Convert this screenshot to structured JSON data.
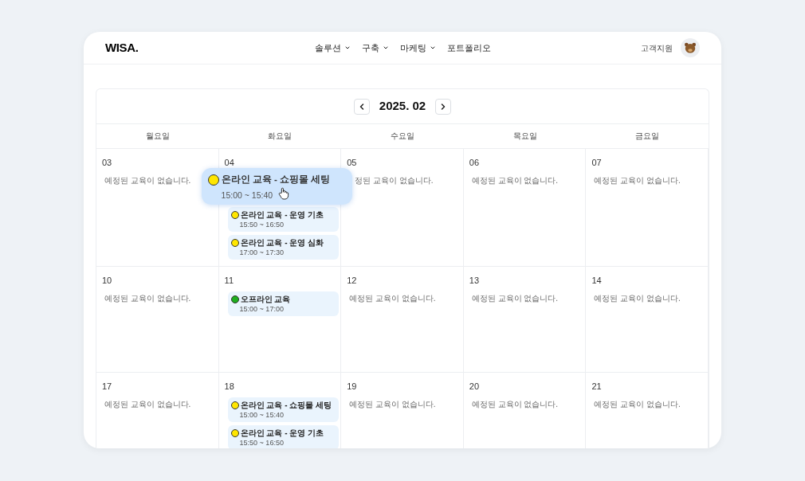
{
  "header": {
    "logo": "WISA.",
    "nav": [
      {
        "label": "솔루션",
        "has_menu": true
      },
      {
        "label": "구축",
        "has_menu": true
      },
      {
        "label": "마케팅",
        "has_menu": true
      },
      {
        "label": "포트폴리오",
        "has_menu": false
      }
    ],
    "support": "고객지원"
  },
  "calendar": {
    "month": "2025. 02",
    "weekdays": [
      "월요일",
      "화요일",
      "수요일",
      "목요일",
      "금요일"
    ],
    "weeks": [
      [
        {
          "date": "03",
          "empty": "예정된 교육이 없습니다.",
          "covered": false
        },
        {
          "date": "04",
          "events": [
            {
              "title": "온라인 교육 - 쇼핑몰 세팅",
              "time": "15:00 ~ 15:40",
              "color": "#ffe600",
              "dragging": true
            },
            {
              "title": "온라인 교육 - 운영 기초",
              "time": "15:50 ~ 16:50",
              "color": "#ffe600",
              "dragging": false
            },
            {
              "title": "온라인 교육 - 운영 심화",
              "time": "17:00 ~ 17:30",
              "color": "#ffe600",
              "dragging": false
            }
          ]
        },
        {
          "date": "05",
          "empty": "정된 교육이 없습니다.",
          "covered": true
        },
        {
          "date": "06",
          "empty": "예정된 교육이 없습니다.",
          "covered": false
        },
        {
          "date": "07",
          "empty": "예정된 교육이 없습니다.",
          "covered": false
        }
      ],
      [
        {
          "date": "10",
          "empty": "예정된 교육이 없습니다.",
          "covered": false
        },
        {
          "date": "11",
          "events": [
            {
              "title": "오프라인 교육",
              "time": "15:00 ~ 17:00",
              "color": "#1fae1f",
              "dragging": false
            }
          ]
        },
        {
          "date": "12",
          "empty": "예정된 교육이 없습니다.",
          "covered": false
        },
        {
          "date": "13",
          "empty": "예정된 교육이 없습니다.",
          "covered": false
        },
        {
          "date": "14",
          "empty": "예정된 교육이 없습니다.",
          "covered": false
        }
      ],
      [
        {
          "date": "17",
          "empty": "예정된 교육이 없습니다.",
          "covered": false
        },
        {
          "date": "18",
          "events": [
            {
              "title": "온라인 교육 - 쇼핑몰 세팅",
              "time": "15:00 ~ 15:40",
              "color": "#ffe600",
              "dragging": false
            },
            {
              "title": "온라인 교육 - 운영 기초",
              "time": "15:50 ~ 16:50",
              "color": "#ffe600",
              "dragging": false
            }
          ]
        },
        {
          "date": "19",
          "empty": "예정된 교육이 없습니다.",
          "covered": false
        },
        {
          "date": "20",
          "empty": "예정된 교육이 없습니다.",
          "covered": false
        },
        {
          "date": "21",
          "empty": "예정된 교육이 없습니다.",
          "covered": false
        }
      ]
    ]
  }
}
